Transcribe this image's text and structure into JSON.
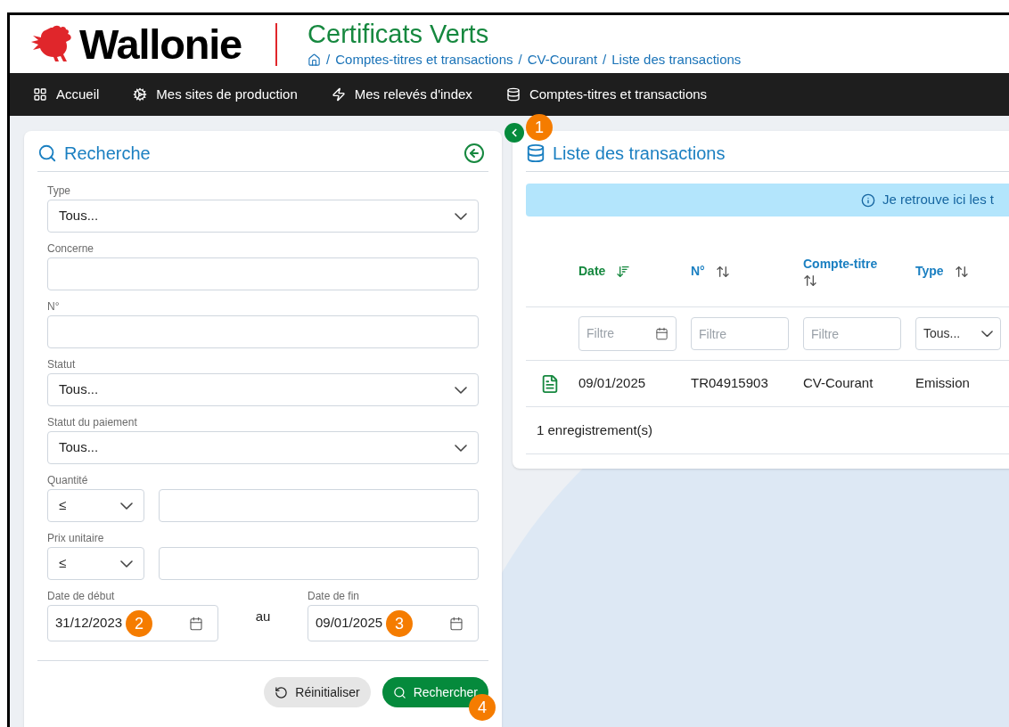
{
  "header": {
    "logo_text": "Wallonie",
    "app_title": "Certificats Verts",
    "breadcrumb": [
      {
        "label": "Comptes-titres et transactions"
      },
      {
        "label": "CV-Courant"
      },
      {
        "label": "Liste des transactions"
      }
    ],
    "separator": "/"
  },
  "nav": {
    "items": [
      {
        "label": "Accueil"
      },
      {
        "label": "Mes sites de production"
      },
      {
        "label": "Mes relevés d'index"
      },
      {
        "label": "Comptes-titres et transactions"
      }
    ]
  },
  "search_panel": {
    "title": "Recherche",
    "fields": [
      {
        "kind": "select",
        "label": "Type",
        "value": "Tous..."
      },
      {
        "kind": "text",
        "label": "Concerne"
      },
      {
        "kind": "text",
        "label": "N°"
      },
      {
        "kind": "select",
        "label": "Statut",
        "value": "Tous..."
      },
      {
        "kind": "select",
        "label": "Statut du paiement",
        "value": "Tous..."
      },
      {
        "kind": "compare",
        "label": "Quantité",
        "operator": "≤"
      },
      {
        "kind": "compare",
        "label": "Prix unitaire",
        "operator": "≤"
      }
    ],
    "date_range": {
      "start": {
        "label": "Date de début",
        "value": "31/12/2023",
        "callout": "2"
      },
      "separator": "au",
      "end": {
        "label": "Date de fin",
        "value": "09/01/2025",
        "callout": "3"
      }
    },
    "buttons": [
      {
        "kind": "reset",
        "label": "Réinitialiser"
      },
      {
        "kind": "search",
        "label": "Rechercher",
        "callout": "4"
      }
    ]
  },
  "collapse_callout": "1",
  "transactions": {
    "title": "Liste des transactions",
    "info": "Je retrouve ici les t",
    "columns": [
      {
        "label": "Date",
        "sorted": true,
        "filter": {
          "kind": "date",
          "placeholder": "Filtre"
        }
      },
      {
        "label": "N°",
        "sorted": false,
        "filter": {
          "kind": "text",
          "placeholder": "Filtre"
        }
      },
      {
        "label": "Compte-titre",
        "sorted": false,
        "filter": {
          "kind": "text",
          "placeholder": "Filtre"
        }
      },
      {
        "label": "Type",
        "sorted": false,
        "filter": {
          "kind": "select",
          "value": "Tous..."
        }
      }
    ],
    "rows": [
      {
        "cells": [
          "09/01/2025",
          "TR04915903",
          "CV-Courant",
          "Emission"
        ]
      }
    ],
    "footer": "1 enregistrement(s)"
  }
}
